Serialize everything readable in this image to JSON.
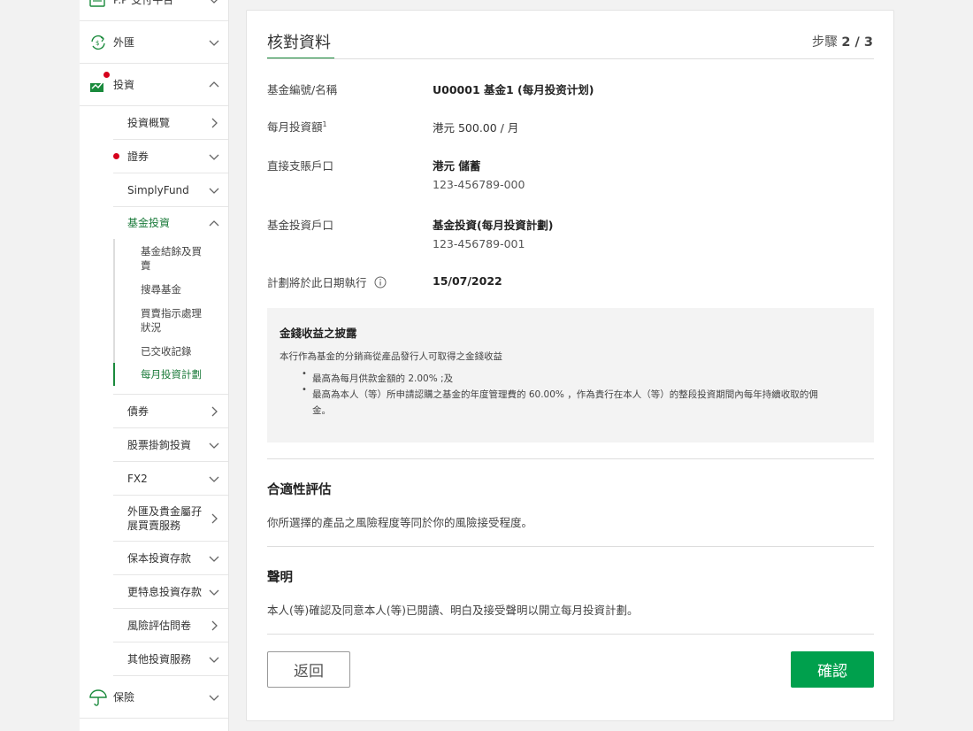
{
  "sidebar": {
    "top": [
      {
        "label": "P.P 支付平台",
        "icon": "payment-icon"
      },
      {
        "label": "外匯",
        "icon": "fx-icon"
      },
      {
        "label": "投資",
        "icon": "investment-icon"
      },
      {
        "label": "保險",
        "icon": "insurance-icon"
      }
    ],
    "sub": [
      {
        "label": "投資概覽"
      },
      {
        "label": "證券"
      },
      {
        "label": "SimplyFund"
      },
      {
        "label": "基金投資"
      },
      {
        "label": "債券"
      },
      {
        "label": "股票掛鉤投資"
      },
      {
        "label": "FX2"
      },
      {
        "label": "外匯及貴金屬孖展買賣服務"
      },
      {
        "label": "保本投資存款"
      },
      {
        "label": "更特息投資存款"
      },
      {
        "label": "風險評估問卷"
      },
      {
        "label": "其他投資服務"
      }
    ],
    "fund_children": [
      {
        "label": "基金結餘及買賣"
      },
      {
        "label": "搜尋基金"
      },
      {
        "label": "買賣指示處理狀況"
      },
      {
        "label": "已交收記錄"
      },
      {
        "label": "每月投資計劃"
      }
    ]
  },
  "main": {
    "title": "核對資料",
    "step_prefix": "步驟",
    "step_value": "2 / 3",
    "fields": {
      "fund_label": "基金編號/名稱",
      "fund_value": "U00001 基金1 (每月投资计划)",
      "amount_label": "每月投資額",
      "amount_sup": "1",
      "amount_value": "港元 500.00 / 月",
      "debit_label": "直接支賬戶口",
      "debit_value": "港元 儲蓄",
      "debit_account": "123-456789-000",
      "fund_acc_label": "基金投資戶口",
      "fund_acc_value": "基金投資(每月投資計劃)",
      "fund_acc_number": "123-456789-001",
      "date_label": "計劃將於此日期執行",
      "date_value": "15/07/2022"
    },
    "disclosure": {
      "title": "金錢收益之披露",
      "intro": "本行作為基金的分銷商從產品發行人可取得之金錢收益",
      "bullet1": "最高為每月供款金額的 2.00% ;及",
      "bullet2_line1": "最高為本人（等）所申請認購之基金的年度管理費的 60.00% ，作為貴行在本人（等）的整段投資期間內每年持續收取的佣",
      "bullet2_line2": "金。"
    },
    "suitability": {
      "title": "合適性評估",
      "text": "你所選擇的產品之風險程度等同於你的風險接受程度。"
    },
    "declaration": {
      "title": "聲明",
      "text": "本人(等)確認及同意本人(等)已閱讀、明白及接受聲明以開立每月投資計劃。"
    },
    "buttons": {
      "back": "返回",
      "confirm": "確認"
    }
  },
  "colors": {
    "accent": "#00a04d",
    "accent_text": "#1a7a3a",
    "alert_dot": "#d6001c",
    "disclosure_bg": "#f3f3f3"
  }
}
